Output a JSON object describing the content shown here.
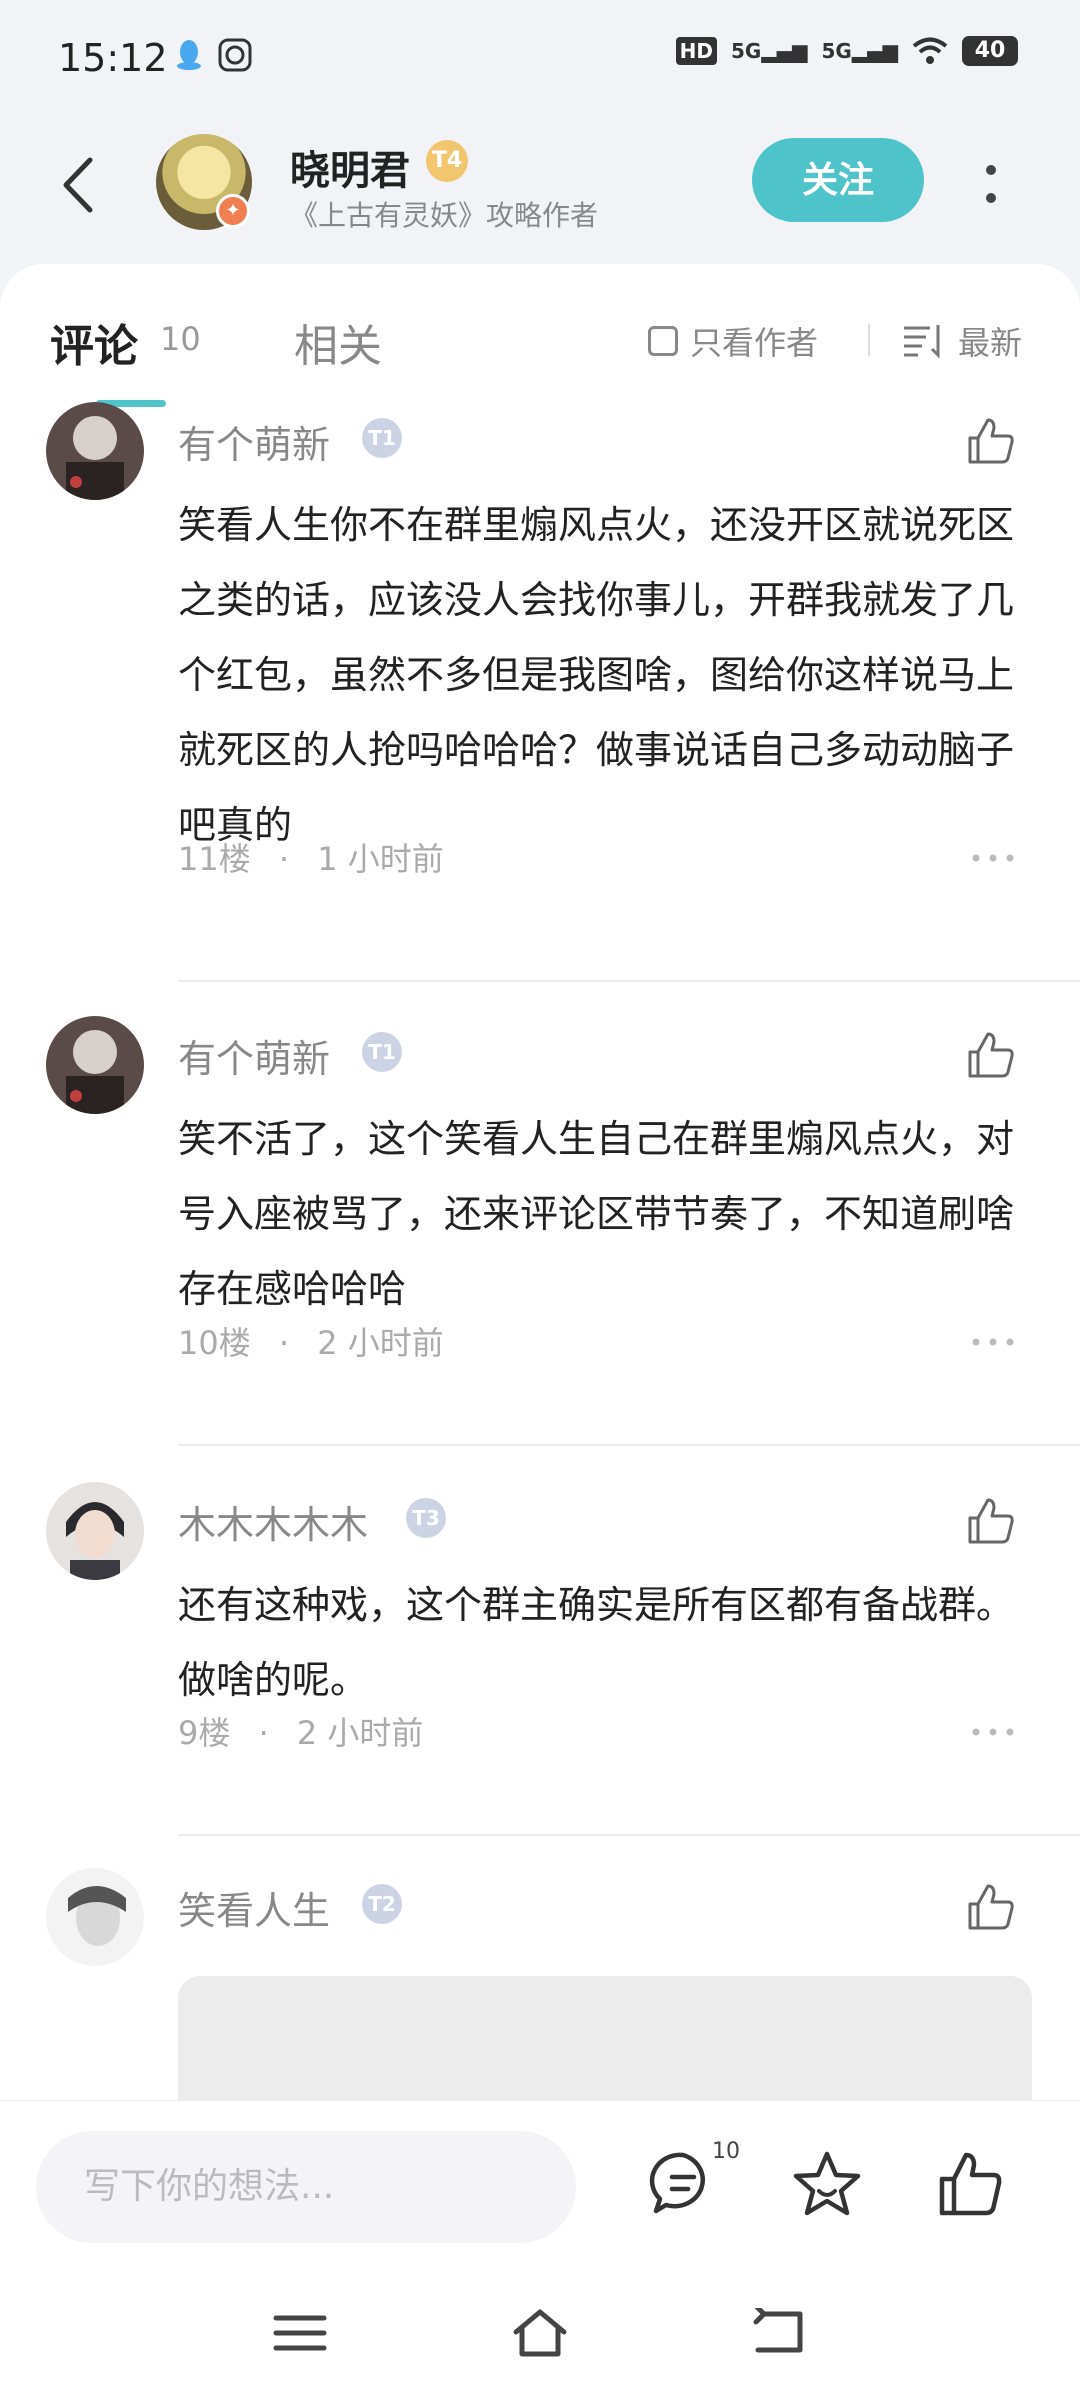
{
  "status_bar": {
    "time": "15:12",
    "network_labels": [
      "HD",
      "5G",
      "5G"
    ],
    "battery": "40"
  },
  "header": {
    "author_name": "晓明君",
    "author_level": "T4",
    "author_desc": "《上古有灵妖》攻略作者",
    "follow_label": "关注"
  },
  "tabs": {
    "comments_label": "评论",
    "comments_count": "10",
    "related_label": "相关",
    "author_only_label": "只看作者",
    "sort_label": "最新"
  },
  "comments": [
    {
      "name": "有个萌新",
      "level": "T1",
      "text": "笑看人生你不在群里煽风点火，还没开区就说死区之类的话，应该没人会找你事儿，开群我就发了几个红包，虽然不多但是我图啥，图给你这样说马上就死区的人抢吗哈哈哈？做事说话自己多动动脑子吧真的",
      "floor": "11楼",
      "time": "1 小时前"
    },
    {
      "name": "有个萌新",
      "level": "T1",
      "text": "笑不活了，这个笑看人生自己在群里煽风点火，对号入座被骂了，还来评论区带节奏了，不知道刷啥存在感哈哈哈",
      "floor": "10楼",
      "time": "2 小时前"
    },
    {
      "name": "木木木木木",
      "level": "T3",
      "text": "还有这种戏，这个群主确实是所有区都有备战群。做啥的呢。",
      "floor": "9楼",
      "time": "2 小时前"
    },
    {
      "name": "笑看人生",
      "level": "T2"
    }
  ],
  "bottom_bar": {
    "input_placeholder": "写下你的想法...",
    "comment_count": "10"
  },
  "colors": {
    "accent": "#4ec3c9",
    "level_gold": "#f2c66f",
    "level_grey": "#cbd3e4"
  }
}
